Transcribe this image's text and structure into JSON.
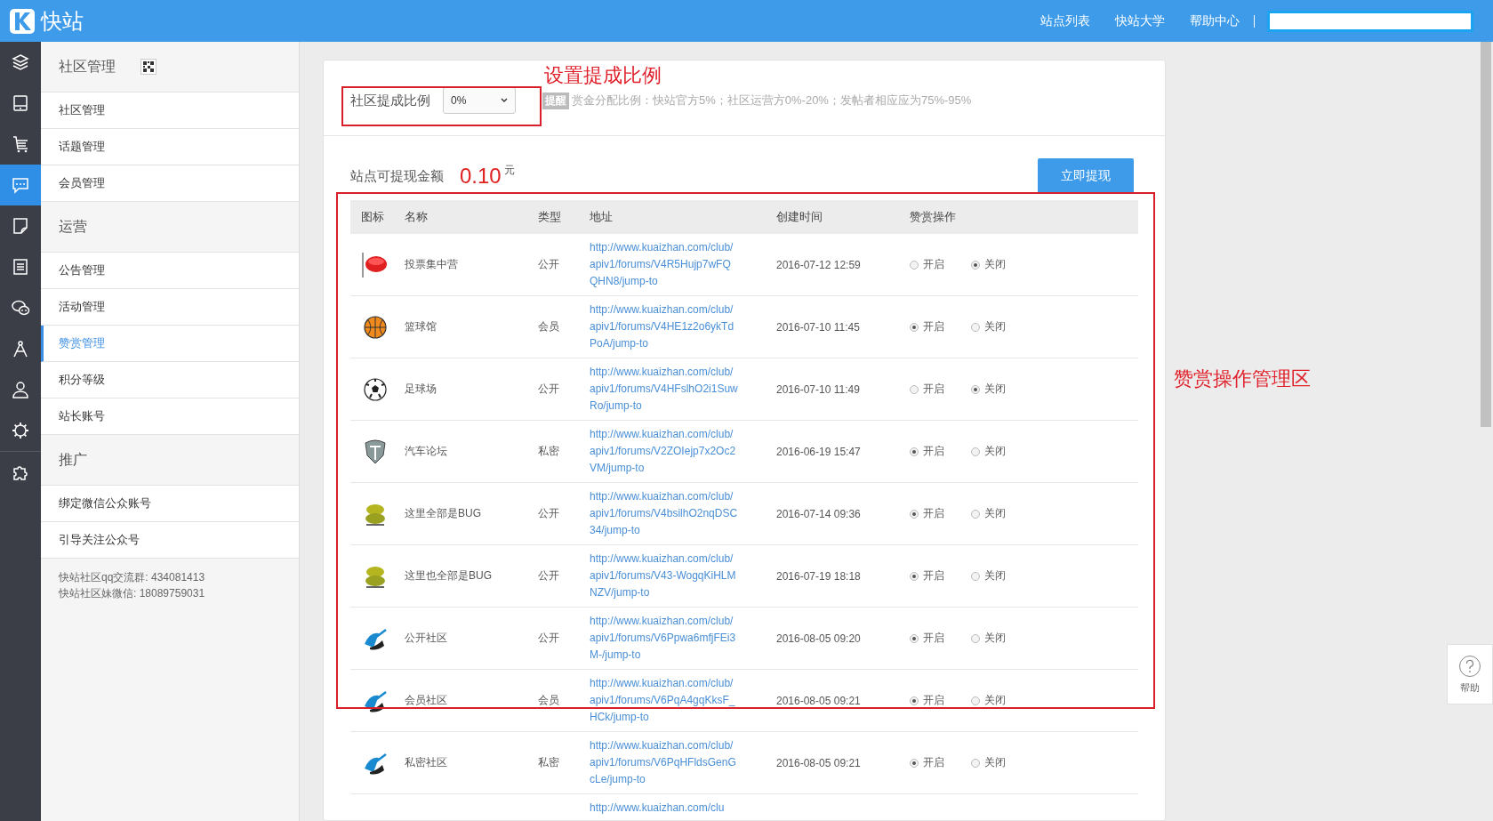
{
  "topbar": {
    "logo_text": "快站",
    "nav": [
      "站点列表",
      "快站大学",
      "帮助中心"
    ]
  },
  "rail": [
    {
      "kind": "layers",
      "selected": false
    },
    {
      "kind": "tablet",
      "selected": false
    },
    {
      "kind": "cart",
      "selected": false
    },
    {
      "kind": "chat",
      "selected": true
    },
    {
      "kind": "note",
      "selected": false
    },
    {
      "kind": "list",
      "selected": false
    },
    {
      "kind": "wechat",
      "selected": false
    },
    {
      "kind": "compass",
      "selected": false
    },
    {
      "kind": "user",
      "selected": false
    },
    {
      "kind": "gear",
      "selected": false
    },
    {
      "kind": "puzzle",
      "selected": false
    }
  ],
  "sidebar": {
    "sections": [
      {
        "title": "社区管理",
        "qr": true,
        "items": [
          {
            "label": "社区管理",
            "selected": false
          },
          {
            "label": "话题管理",
            "selected": false
          },
          {
            "label": "会员管理",
            "selected": false
          }
        ]
      },
      {
        "title": "运营",
        "qr": false,
        "items": [
          {
            "label": "公告管理",
            "selected": false
          },
          {
            "label": "活动管理",
            "selected": false
          },
          {
            "label": "赞赏管理",
            "selected": true
          },
          {
            "label": "积分等级",
            "selected": false
          },
          {
            "label": "站长账号",
            "selected": false
          }
        ]
      },
      {
        "title": "推广",
        "qr": false,
        "items": [
          {
            "label": "绑定微信公众账号",
            "selected": false
          },
          {
            "label": "引导关注公众号",
            "selected": false
          }
        ]
      }
    ],
    "footer": [
      "快站社区qq交流群: 434081413",
      "快站社区妹微信: 18089759031"
    ]
  },
  "settings": {
    "label": "社区提成比例",
    "select_value": "0%",
    "notice_tag": "提醒",
    "notice": "赏金分配比例：快站官方5%；社区运营方0%-20%；发帖者相应应为75%-95%"
  },
  "balance": {
    "label": "站点可提现金额",
    "amount": "0.10",
    "unit": "元",
    "button": "立即提现"
  },
  "table": {
    "columns": [
      "图标",
      "名称",
      "类型",
      "地址",
      "创建时间",
      "赞赏操作"
    ],
    "rows": [
      {
        "kind": "vote",
        "name": "投票集中营",
        "type": "公开",
        "address": "http://www.kuaizhan.com/club/apiv1/forums/V4R5Hujp7wFQQHN8/jump-to",
        "created": "2016-07-12 12:59",
        "options": [
          {
            "label": "开启",
            "selected": false
          },
          {
            "label": "关闭",
            "selected": true
          }
        ]
      },
      {
        "kind": "basketball",
        "name": "篮球馆",
        "type": "会员",
        "address": "http://www.kuaizhan.com/club/apiv1/forums/V4HE1z2o6ykTdPoA/jump-to",
        "created": "2016-07-10 11:45",
        "options": [
          {
            "label": "开启",
            "selected": true
          },
          {
            "label": "关闭",
            "selected": false
          }
        ]
      },
      {
        "kind": "soccer",
        "name": "足球场",
        "type": "公开",
        "address": "http://www.kuaizhan.com/club/apiv1/forums/V4HFslhO2i1SuwRo/jump-to",
        "created": "2016-07-10 11:49",
        "options": [
          {
            "label": "开启",
            "selected": false
          },
          {
            "label": "关闭",
            "selected": true
          }
        ]
      },
      {
        "kind": "shield",
        "name": "汽车论坛",
        "type": "私密",
        "address": "http://www.kuaizhan.com/club/apiv1/forums/V2ZOIejp7x2Oc2VM/jump-to",
        "created": "2016-06-19 15:47",
        "options": [
          {
            "label": "开启",
            "selected": true
          },
          {
            "label": "关闭",
            "selected": false
          }
        ]
      },
      {
        "kind": "sticker",
        "name": "这里全部是BUG",
        "type": "公开",
        "address": "http://www.kuaizhan.com/club/apiv1/forums/V4bsilhO2nqDSC34/jump-to",
        "created": "2016-07-14 09:36",
        "options": [
          {
            "label": "开启",
            "selected": true
          },
          {
            "label": "关闭",
            "selected": false
          }
        ]
      },
      {
        "kind": "sticker",
        "name": "这里也全部是BUG",
        "type": "公开",
        "address": "http://www.kuaizhan.com/club/apiv1/forums/V43-WogqKiHLMNZV/jump-to",
        "created": "2016-07-19 18:18",
        "options": [
          {
            "label": "开启",
            "selected": true
          },
          {
            "label": "关闭",
            "selected": false
          }
        ]
      },
      {
        "kind": "swoosh",
        "name": "公开社区",
        "type": "公开",
        "address": "http://www.kuaizhan.com/club/apiv1/forums/V6Ppwa6mfjFEi3M-/jump-to",
        "created": "2016-08-05 09:20",
        "options": [
          {
            "label": "开启",
            "selected": true
          },
          {
            "label": "关闭",
            "selected": false
          }
        ]
      },
      {
        "kind": "swoosh",
        "name": "会员社区",
        "type": "会员",
        "address": "http://www.kuaizhan.com/club/apiv1/forums/V6PqA4gqKksF_HCk/jump-to",
        "created": "2016-08-05 09:21",
        "options": [
          {
            "label": "开启",
            "selected": true
          },
          {
            "label": "关闭",
            "selected": false
          }
        ]
      },
      {
        "kind": "swoosh",
        "name": "私密社区",
        "type": "私密",
        "address": "http://www.kuaizhan.com/club/apiv1/forums/V6PqHFldsGenGcLe/jump-to",
        "created": "2016-08-05 09:21",
        "options": [
          {
            "label": "开启",
            "selected": true
          },
          {
            "label": "关闭",
            "selected": false
          }
        ]
      },
      {
        "address": "http://www.kuaizhan.com/clu"
      }
    ]
  },
  "annotations": [
    {
      "kind": "settings",
      "label": "设置提成比例"
    },
    {
      "kind": "table",
      "label": "赞赏操作管理区"
    }
  ],
  "help": {
    "label": "帮助"
  }
}
